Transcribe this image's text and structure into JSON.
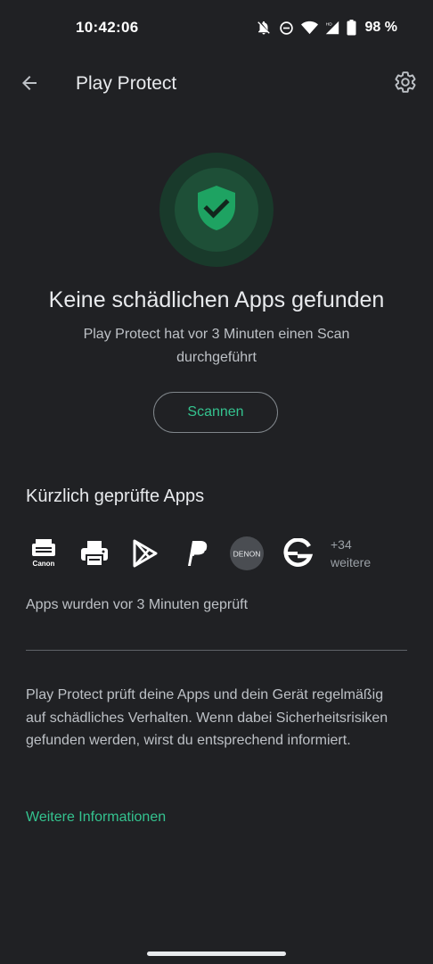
{
  "status_bar": {
    "time": "10:42:06",
    "battery_percent": "98 %",
    "icons": [
      "bell-off-icon",
      "do-not-disturb-icon",
      "wifi-icon",
      "signal-icon",
      "battery-icon"
    ]
  },
  "app_bar": {
    "title": "Play Protect",
    "back_icon": "arrow-back-icon",
    "settings_icon": "gear-icon"
  },
  "status_card": {
    "icon": "shield-check-icon",
    "headline": "Keine schädlichen Apps gefunden",
    "subline": "Play Protect hat vor 3 Minuten einen Scan durchgeführt",
    "scan_button": "Scannen"
  },
  "recent_apps": {
    "title": "Kürzlich geprüfte Apps",
    "apps": [
      {
        "name": "Canon",
        "icon": "canon-printer-icon"
      },
      {
        "name": "Printer",
        "icon": "printer-icon"
      },
      {
        "name": "Play Store",
        "icon": "play-store-icon"
      },
      {
        "name": "PayPal",
        "icon": "paypal-icon"
      },
      {
        "name": "DENON",
        "icon": "denon-icon"
      },
      {
        "name": "G",
        "icon": "g-app-icon"
      }
    ],
    "more_count": "+34",
    "more_label": "weitere",
    "checked_text": "Apps wurden vor 3 Minuten geprüft"
  },
  "info": {
    "text": "Play Protect prüft deine Apps und dein Gerät regelmäßig auf schädliches Verhalten. Wenn dabei Sicherheitsrisiken gefunden werden, wirst du entsprechend informiert.",
    "link": "Weitere Informationen"
  },
  "colors": {
    "background": "#202124",
    "accent": "#34c38f",
    "shield": "#1ea362"
  }
}
